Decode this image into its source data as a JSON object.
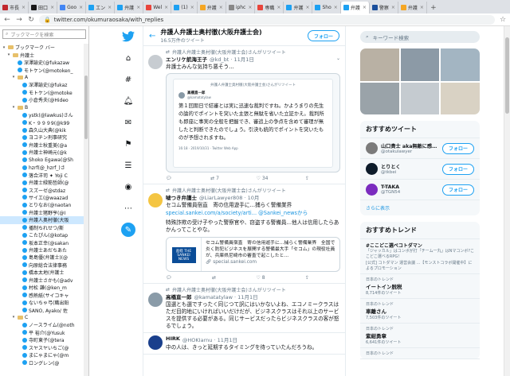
{
  "browser": {
    "tabs": [
      {
        "label": "市長",
        "color": "#c1272d"
      },
      {
        "label": "田口",
        "color": "#1a1a1a"
      },
      {
        "label": "Goo",
        "color": "#4285f4"
      },
      {
        "label": "エン",
        "color": "#1da1f2"
      },
      {
        "label": "弁護",
        "color": "#1da1f2"
      },
      {
        "label": "Wel",
        "color": "#e8453c"
      },
      {
        "label": "(1)",
        "color": "#1da1f2"
      },
      {
        "label": "弁護",
        "color": "#f5a623"
      },
      {
        "label": "iphc",
        "color": "#888888"
      },
      {
        "label": "専職",
        "color": "#e8453c"
      },
      {
        "label": "弁護",
        "color": "#1da1f2"
      },
      {
        "label": "Sho",
        "color": "#1da1f2"
      },
      {
        "label": "弁護",
        "color": "#1da1f2",
        "active": true
      },
      {
        "label": "警察",
        "color": "#1a4f9c"
      },
      {
        "label": "弁護",
        "color": "#f5a623"
      }
    ],
    "url": "twitter.com/okumuraosaka/with_replies"
  },
  "bookmarks": {
    "search_placeholder": "ブックマークを検索",
    "items": [
      {
        "label": "ブックマーク バー",
        "level": 0,
        "type": "folder",
        "open": true
      },
      {
        "label": "弁護士",
        "level": 1,
        "type": "folder",
        "open": true
      },
      {
        "label": "深澤諭史(@fukazaw",
        "level": 2,
        "type": "link"
      },
      {
        "label": "モトケン(@motoken_",
        "level": 2,
        "type": "link"
      },
      {
        "label": "A",
        "level": 2,
        "type": "folder",
        "open": true
      },
      {
        "label": "深澤諭史(@fukaz",
        "level": 3,
        "type": "link"
      },
      {
        "label": "モトケン(@motoke",
        "level": 3,
        "type": "link"
      },
      {
        "label": "小倉秀夫(@Hideo",
        "level": 3,
        "type": "link"
      },
      {
        "label": "B",
        "level": 2,
        "type": "folder",
        "open": true
      },
      {
        "label": "ystk(@lawkus)さん",
        "level": 3,
        "type": "link"
      },
      {
        "label": "K・９９９9(@k99",
        "level": 3,
        "type": "link"
      },
      {
        "label": "森久山大典(@kik",
        "level": 3,
        "type": "link"
      },
      {
        "label": "ヨコチン刑事研究",
        "level": 3,
        "type": "link"
      },
      {
        "label": "弁護士秋重美(@a",
        "level": 3,
        "type": "link"
      },
      {
        "label": "弁護士神崎元(@k",
        "level": 3,
        "type": "link"
      },
      {
        "label": "Shoko Egawa(@Sh",
        "level": 3,
        "type": "link"
      },
      {
        "label": "hzrf(@_hzrf_)さ",
        "level": 3,
        "type": "link"
      },
      {
        "label": "落合洋司 ✦ Yoji C",
        "level": 3,
        "type": "link"
      },
      {
        "label": "弁護士緑筋哲師(@",
        "level": 3,
        "type": "link"
      },
      {
        "label": "スズーゼ@stdaz",
        "level": 3,
        "type": "link"
      },
      {
        "label": "サイエ(@waazad",
        "level": 3,
        "type": "link"
      },
      {
        "label": "とりなお(@naotan",
        "level": 3,
        "type": "link"
      },
      {
        "label": "弁護士猪野亨(@I",
        "level": 3,
        "type": "link"
      },
      {
        "label": "弁護人奥村徹(大阪",
        "level": 3,
        "type": "link",
        "selected": true
      },
      {
        "label": "播制ちれせつ/斯",
        "level": 3,
        "type": "link"
      },
      {
        "label": "こたぴん(@kotap",
        "level": 3,
        "type": "link"
      },
      {
        "label": "坂本正幸(@sakan",
        "level": 3,
        "type": "link"
      },
      {
        "label": "弁護士あだちあた",
        "level": 3,
        "type": "link"
      },
      {
        "label": "島島優(弁護士)(@",
        "level": 3,
        "type": "link"
      },
      {
        "label": "向原総合法律事務",
        "level": 3,
        "type": "link"
      },
      {
        "label": "橋本太地(弁護士",
        "level": 3,
        "type": "link"
      },
      {
        "label": "弁護士さかも(@adv",
        "level": 3,
        "type": "link"
      },
      {
        "label": "村松 謙(@ken_m",
        "level": 3,
        "type": "link"
      },
      {
        "label": "感熱紙(サイコキャ",
        "level": 3,
        "type": "link"
      },
      {
        "label": "ないちゃ弓(職出鉛",
        "level": 3,
        "type": "link"
      },
      {
        "label": "SANO, Ayako/ 佐",
        "level": 3,
        "type": "link"
      },
      {
        "label": "C",
        "level": 2,
        "type": "folder",
        "open": true
      },
      {
        "label": "ノースライム(@noth",
        "level": 3,
        "type": "link"
      },
      {
        "label": "平 裕介(@Yusuk",
        "level": 3,
        "type": "link"
      },
      {
        "label": "寺町東子(@tera",
        "level": 3,
        "type": "link"
      },
      {
        "label": "スヤスヤいちご(@",
        "level": 3,
        "type": "link"
      },
      {
        "label": "まにゃまにゃ(@m",
        "level": 3,
        "type": "link"
      },
      {
        "label": "ロングレン(@",
        "level": 3,
        "type": "link"
      }
    ]
  },
  "header": {
    "title": "弁護人弁護士奥村徹(大阪弁護士会)",
    "count": "16.5万件のツイート",
    "follow_label": "フォロー"
  },
  "tweets": [
    {
      "rt": "弁護人弁護士奥村徹(大阪弁護士会)さんがリツイート",
      "name": "エンリケ航海王子",
      "handle": "@kd_bt · 11月1日",
      "text": "弁護士みんな気持ち悪そう…",
      "avatar": "#b9c1c9",
      "card": {
        "rt": "弁護人弁護士奥村徹(大阪弁護士会)さんがリツイート",
        "name": "高橋直一郎",
        "handle": "@kamatatylaw",
        "text": "第１回期日で結審とは実に迅速な裁判ですね。かようまりの先生の論的でポイントを突いた主張と無駄を省いた立証かえ。裁判所も即座に事実の全般を把握でき、審追上の争点を含めて審理が無したと判断できたのでしょう。引決も統的でポイントを突いたものが予想されますね。",
        "meta": "16:18 · 2019/10/31 · Twitter Web App"
      },
      "actions": {
        "reply": "",
        "retweet": "7",
        "like": "34"
      }
    },
    {
      "rt": "弁護人弁護士奥村徹(大阪弁護士会)さんがリツイート",
      "name": "嘘つき弁護士",
      "handle": "@LiarLawyer808 · 10月",
      "text": "セコム警備員宿直　寄の信用遊手に…捕らく警備業界",
      "link": "special.sankei.com/a/society/arti... @Sankei_newsから",
      "text2": "特殊詐欺の受け子やった警察官や、窃盗する警備員…他人は信用したらあかんってことやな。",
      "avatar": "#ffd166",
      "linkcard": {
        "logo": "産経 THE SANKEI NEWS",
        "text": "セコム警備員宿直　寄の信用遊手に…捕らく警備業界　全国で炎く防犯ビジネスを展開する警備最大手「セコム」の現役社員が、兵庫県尼崎市の審査で起こしたと…",
        "domain": "special.sankei.com"
      },
      "actions": {
        "reply": "",
        "retweet": "",
        "like": "8"
      }
    },
    {
      "rt": "弁護人弁護士奥村徹(大阪弁護士会)さんがリツイート",
      "name": "高橋直一郎",
      "handle": "@kamatatylaw · 11月1日",
      "text": "国選とも選ですったく同じつて訳にはいかないよね、エコノミークラスはただ目的地にいければいいだけだが、ビジネスクラスはそれ以上のサービスを提供する必要がある。同じサービスだったらビジネスクラスの客が怒るでしょう。",
      "avatar": "#8a9ba8"
    },
    {
      "rt": "",
      "name": "HIRK",
      "handle": "@HOKIarnu · 11月1日",
      "text": "中の人は、きっと延期するタイミングを待っていたんだろうね。",
      "avatar": "#1a3f8c"
    }
  ],
  "sidebar": {
    "search_placeholder": "キーワード検索",
    "who_title": "おすすめユーザー",
    "who_title_text": "おすすめツイート",
    "users": [
      {
        "name": "山口貴士 aka無敵に感じ…",
        "handle": "@otakulawyer",
        "color": "#7b7b7b"
      },
      {
        "name": "とりとく",
        "handle": "@tkbei",
        "color": "#0d1b2a"
      },
      {
        "name": "T-TAKA",
        "handle": "@TGN54",
        "color": "#7b2cbf"
      }
    ],
    "more_label": "さらに表示",
    "trends_title": "おすすめトレンド",
    "trends": [
      {
        "ctx": "",
        "title": "#ここどこ選ベコトダマン",
        "sub": "「ジャッカル」はコンボが打「チーム一丸」はNマコンボ?ここどこ選ベるRPG!",
        "count": "[公式] コトダマン 運営会議 ...【モンストコラボ開催中】によるプロモーション"
      },
      {
        "ctx": "日本のトレンド",
        "title": "イートイン脱税",
        "count": "8,714件のツイート"
      },
      {
        "ctx": "日本のトレンド",
        "title": "車離さん",
        "count": "7,503件のツイート"
      },
      {
        "ctx": "日本のトレンド",
        "title": "紫紺勇章",
        "count": "6,641件のツイート"
      },
      {
        "ctx": "日本のトレンド",
        "title": "",
        "count": ""
      }
    ]
  }
}
